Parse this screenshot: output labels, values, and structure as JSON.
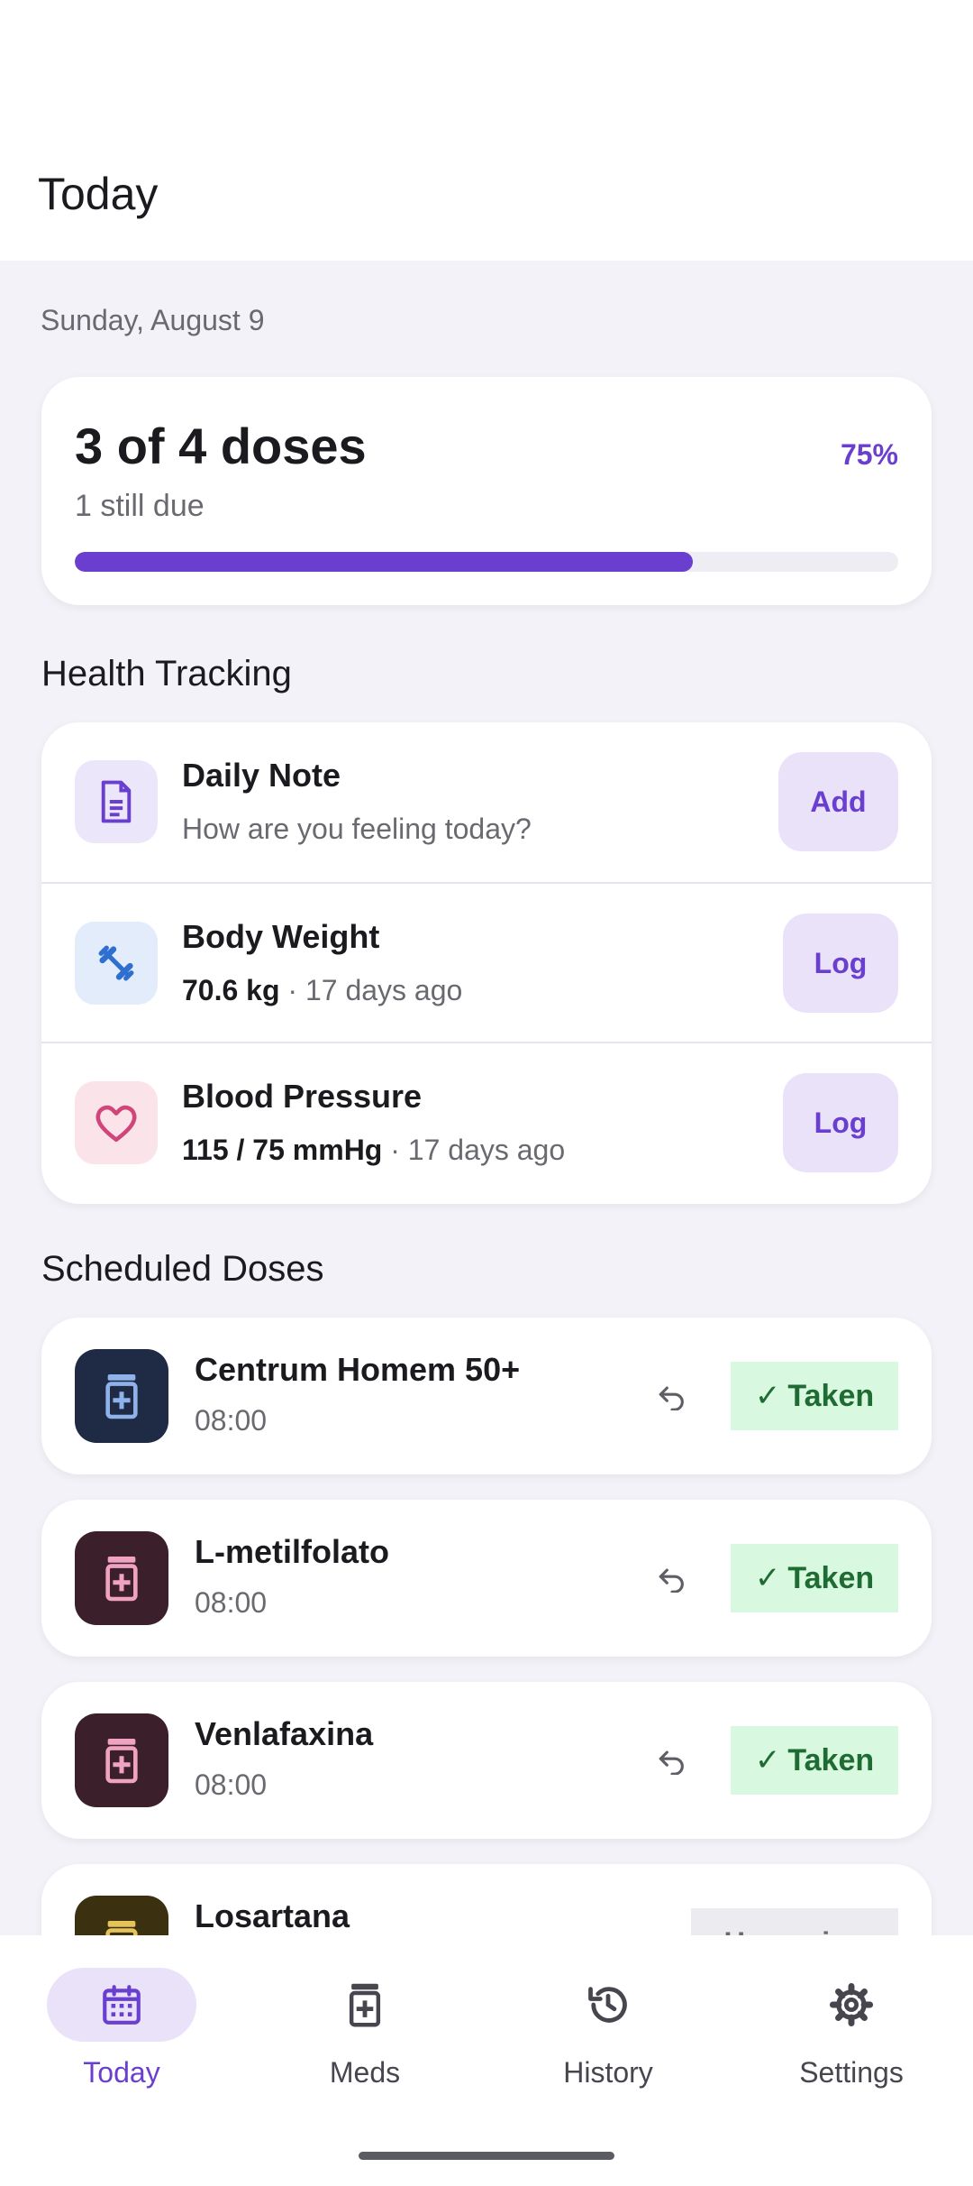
{
  "header": {
    "title": "Today"
  },
  "date_line": "Sunday, August 9",
  "summary": {
    "headline": "3 of 4 doses",
    "subtext": "1 still due",
    "percent_label": "75%",
    "progress": 0.75
  },
  "health_section": {
    "title": "Health Tracking",
    "daily_note": {
      "title": "Daily Note",
      "subtitle": "How are you feeling today?",
      "button": "Add",
      "icon": "document-icon"
    },
    "body_weight": {
      "title": "Body Weight",
      "value": "70.6 kg",
      "separator": " · ",
      "ago": "17 days ago",
      "button": "Log",
      "icon": "scale-icon"
    },
    "blood_pressure": {
      "title": "Blood Pressure",
      "value": "115 / 75 mmHg",
      "separator": " · ",
      "ago": "17 days ago",
      "button": "Log",
      "icon": "heart-icon"
    }
  },
  "doses_section": {
    "title": "Scheduled Doses",
    "doses": [
      {
        "name": "Centrum Homem 50+",
        "time": "08:00",
        "status": "Taken",
        "check": "✓",
        "icon_bg": "#1f2a44",
        "icon_fg": "#8fb2ea"
      },
      {
        "name": "L-metilfolato",
        "time": "08:00",
        "status": "Taken",
        "check": "✓",
        "icon_bg": "#3b1f2a",
        "icon_fg": "#f0a3c0"
      },
      {
        "name": "Venlafaxina",
        "time": "08:00",
        "status": "Taken",
        "check": "✓",
        "icon_bg": "#3b1f2a",
        "icon_fg": "#f0a3c0"
      },
      {
        "name": "Losartana",
        "time": "",
        "status": "Upcoming",
        "icon_bg": "#3b3010",
        "icon_fg": "#e6c35a"
      }
    ]
  },
  "nav": {
    "items": [
      {
        "label": "Today",
        "icon": "calendar-icon",
        "active": true
      },
      {
        "label": "Meds",
        "icon": "pill-bottle-icon",
        "active": false
      },
      {
        "label": "History",
        "icon": "history-icon",
        "active": false
      },
      {
        "label": "Settings",
        "icon": "gear-icon",
        "active": false
      }
    ]
  },
  "colors": {
    "accent": "#6a3fd0",
    "taken_bg": "#d8f8df",
    "taken_fg": "#1f6b34",
    "background": "#f3f2f8"
  }
}
